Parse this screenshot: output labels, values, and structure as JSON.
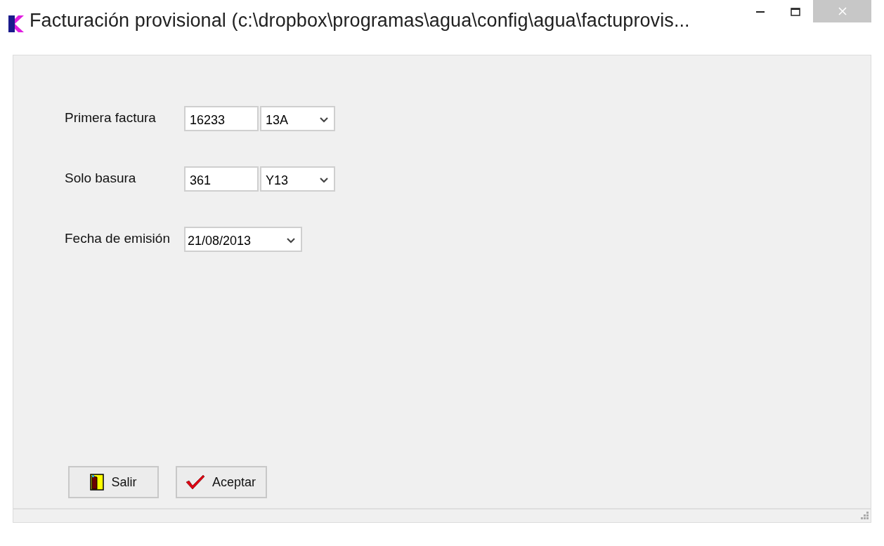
{
  "window": {
    "title": "Facturación provisional (c:\\dropbox\\programas\\agua\\config\\agua\\factuprovis..."
  },
  "fields": [
    {
      "kind": "number-series",
      "label": "Primera factura",
      "value": "16233",
      "series": "13A"
    },
    {
      "kind": "number-series",
      "label": "Solo basura",
      "value": "361",
      "series": "Y13"
    },
    {
      "kind": "date",
      "label": "Fecha de emisión",
      "value": "21/08/2013"
    }
  ],
  "buttons": [
    {
      "kind": "exit",
      "label": "Salir"
    },
    {
      "kind": "accept",
      "label": "Aceptar"
    }
  ]
}
